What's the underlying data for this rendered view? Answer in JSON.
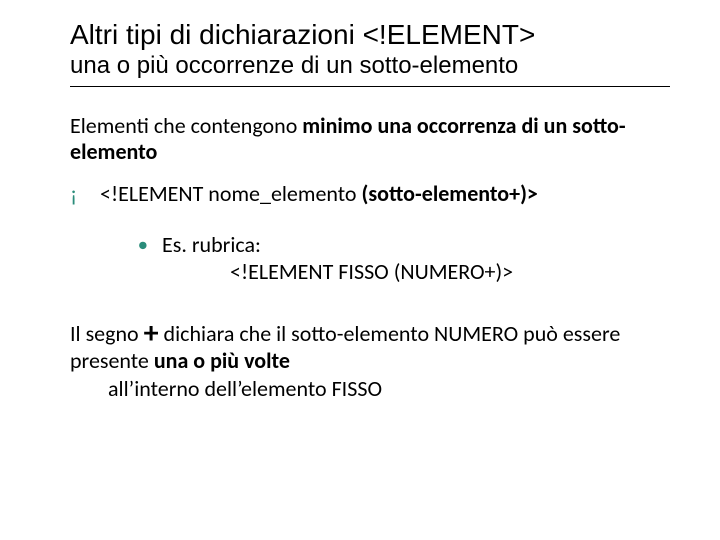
{
  "title": "Altri tipi di dichiarazioni <!ELEMENT>",
  "subtitle": "una o più occorrenze di un sotto-elemento",
  "para1_plain": "Elementi che contengono ",
  "para1_bold": "minimo una occorrenza di un sotto-elemento",
  "bullet_o_plain": "<!ELEMENT nome_elemento ",
  "bullet_o_bold": "(sotto-elemento+)>",
  "example_lead": "Es. ",
  "example_text": "rubrica:",
  "example_code": "<!ELEMENT FISSO (NUMERO+)>",
  "final_pre": "Il segno ",
  "final_plus": "+",
  "final_mid": " dichiara che il sotto-elemento NUMERO può essere presente ",
  "final_bold": "una o più volte ",
  "final_tail": "all’interno dell’elemento FISSO"
}
